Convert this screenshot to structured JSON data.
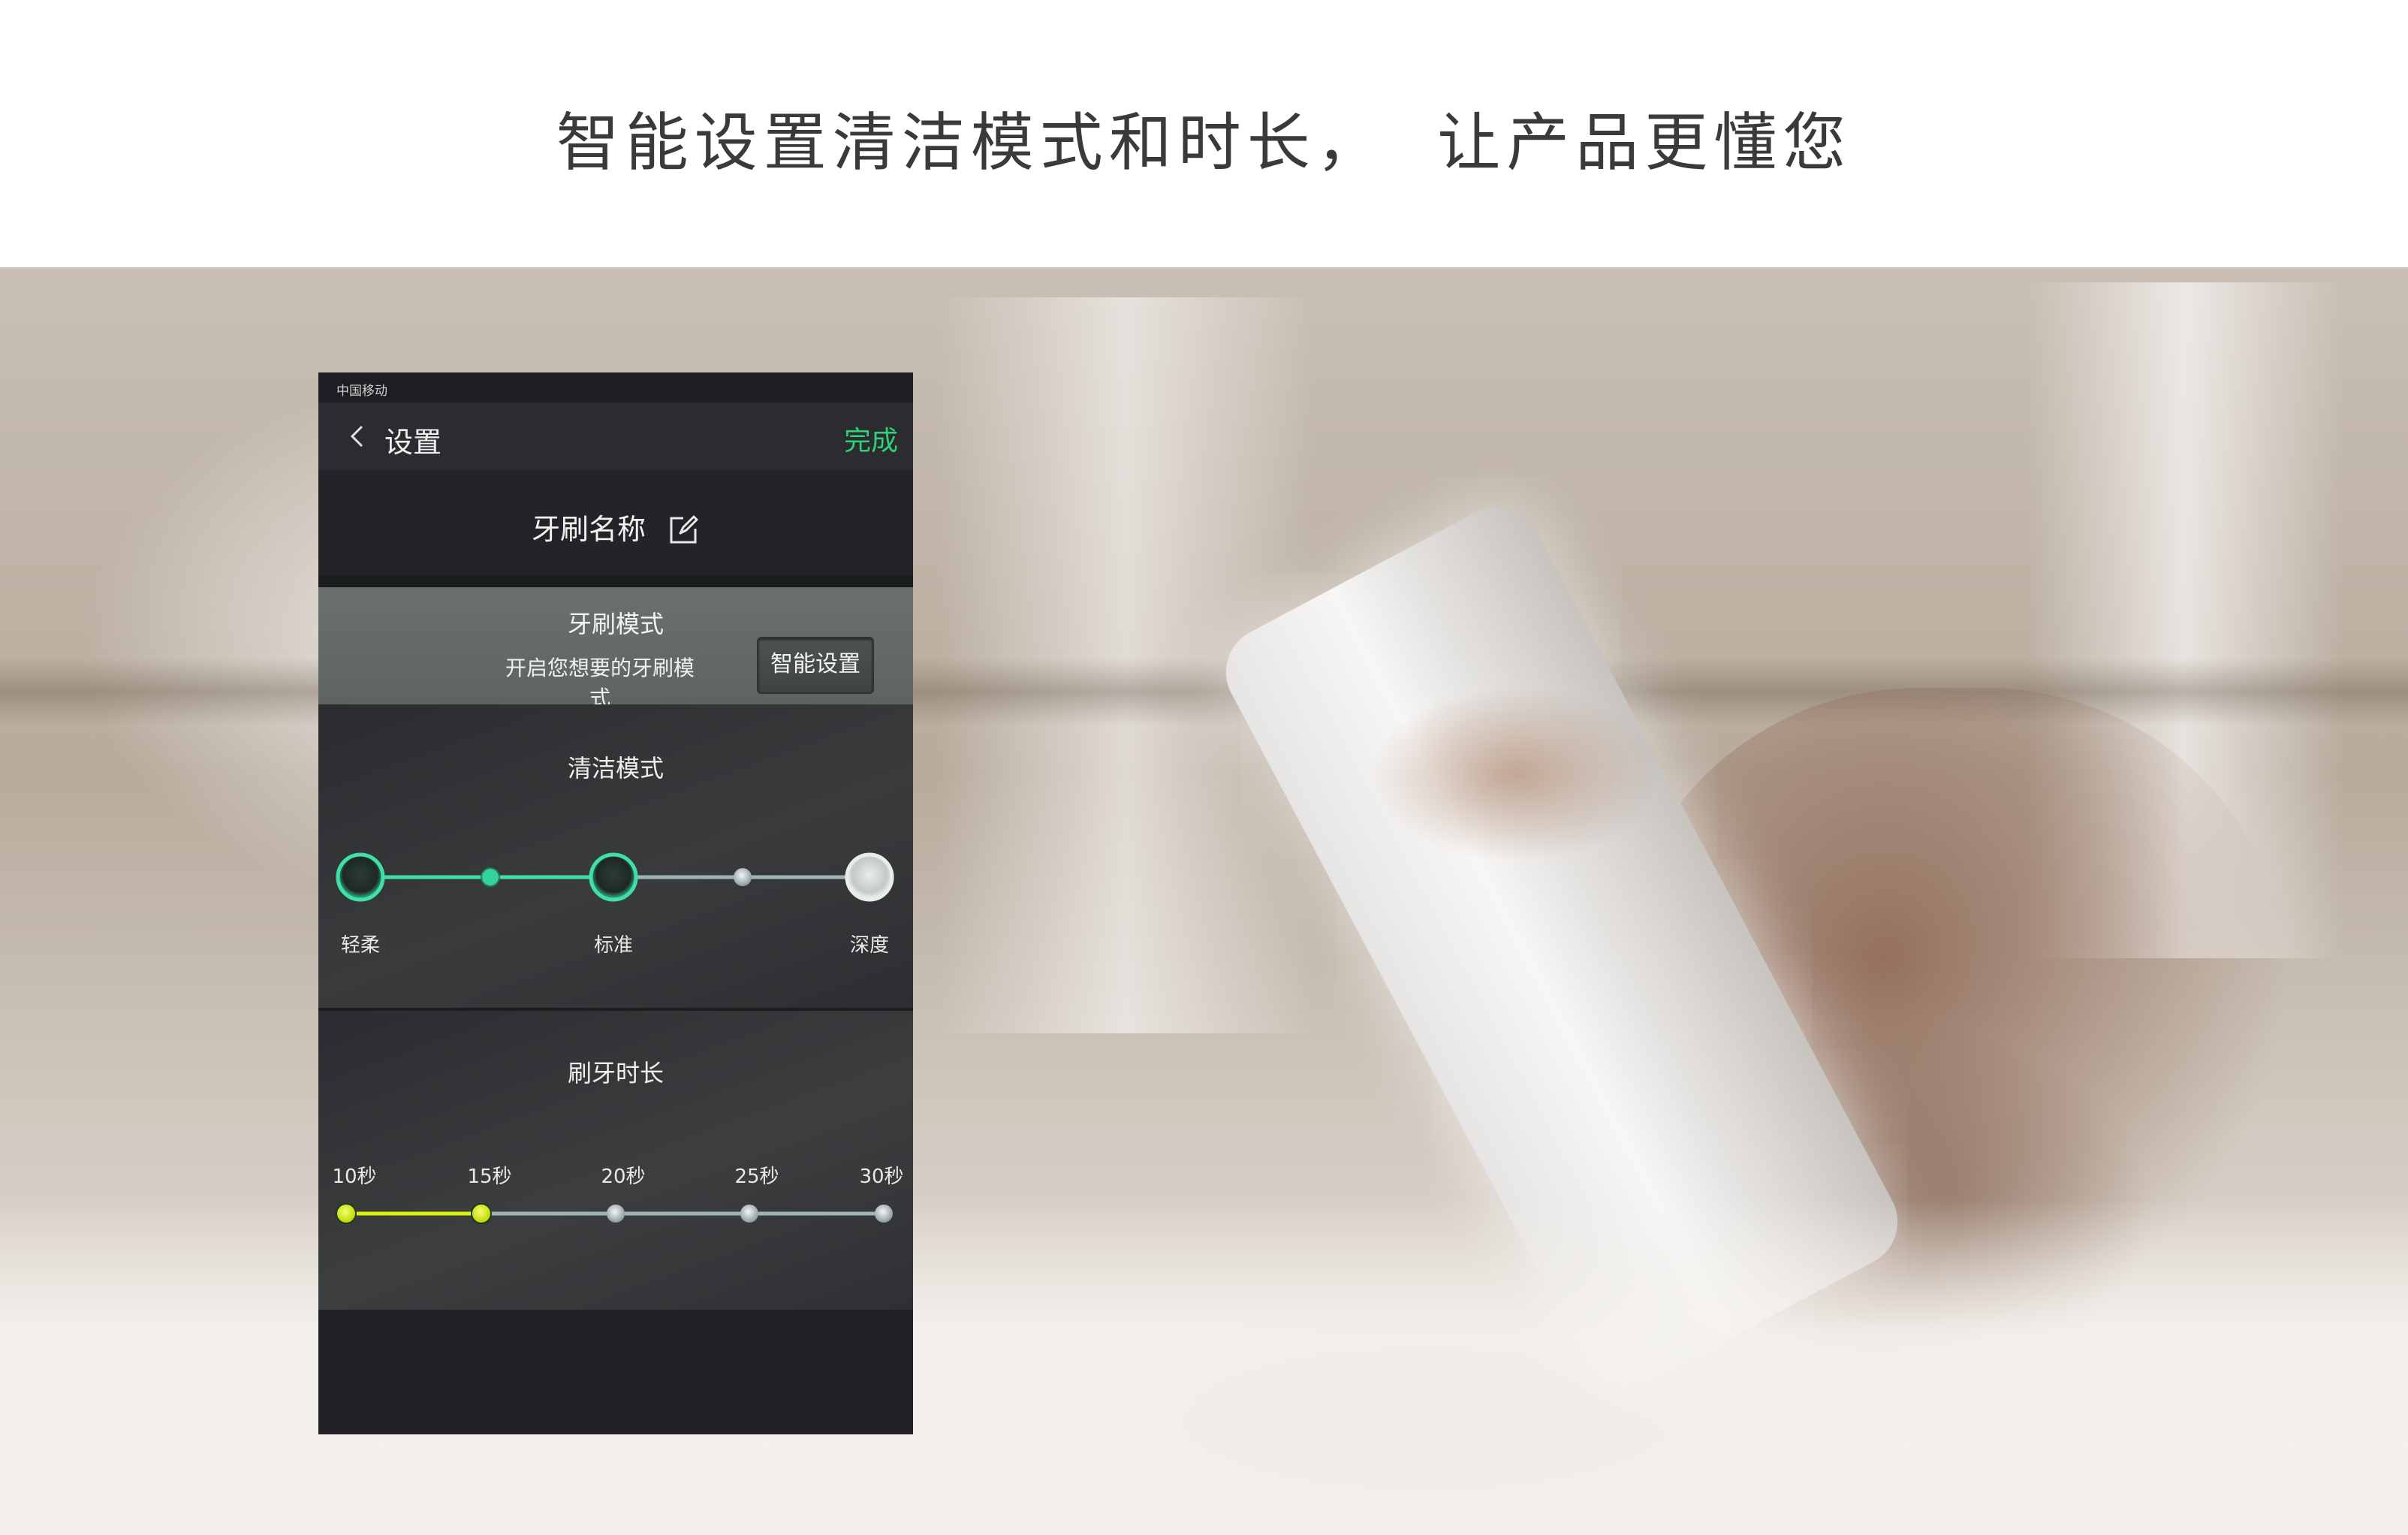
{
  "headline": "智能设置清洁模式和时长，  让产品更懂您",
  "status_bar": {
    "carrier": "中国移动"
  },
  "nav": {
    "title": "设置",
    "done_label": "完成"
  },
  "toothbrush_name": {
    "label": "牙刷名称",
    "icon": "edit-icon"
  },
  "brush_mode": {
    "title": "牙刷模式",
    "subtitle": "开启您想要的牙刷模式",
    "smart_button": "智能设置"
  },
  "clean_mode": {
    "title": "清洁模式",
    "options": [
      "轻柔",
      "标准",
      "深度"
    ],
    "selected": "标准",
    "accent": "#35d39b"
  },
  "brush_duration": {
    "title": "刷牙时长",
    "options": [
      "10秒",
      "15秒",
      "20秒",
      "25秒",
      "30秒"
    ],
    "selected": "15秒",
    "accent": "#d8f20a"
  }
}
